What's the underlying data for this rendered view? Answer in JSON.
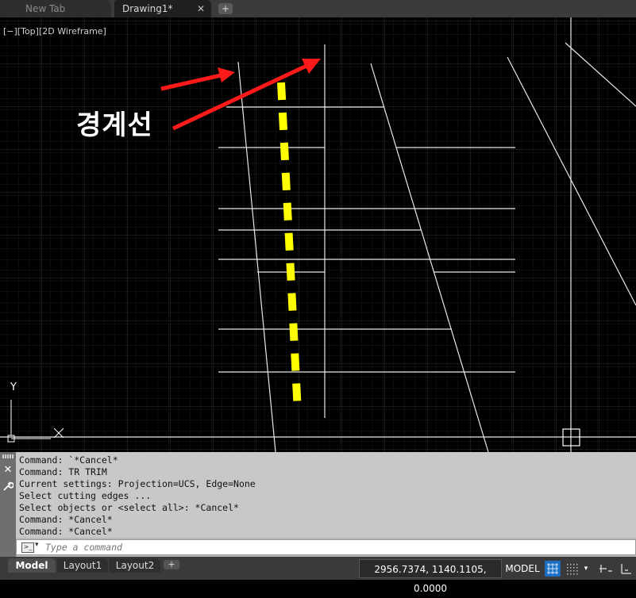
{
  "tabs": {
    "new_tab": "New Tab",
    "drawing_tab": "Drawing1*",
    "close_glyph": "✕",
    "add_glyph": "+"
  },
  "viewport": {
    "view_label": "[−][Top][2D Wireframe]",
    "annotation_text": "경계선",
    "annotation_color": "#ff1a1a",
    "dashed_line_color": "#ffff00",
    "background": "#000000",
    "ucs_y_label": "Y",
    "ucs_x_label": "X"
  },
  "command": {
    "history": [
      "Command: `*Cancel*",
      "Command: TR TRIM",
      "Current settings: Projection=UCS, Edge=None",
      "Select cutting edges ...",
      "Select objects or <select all>: *Cancel*",
      "Command: *Cancel*",
      "Command: *Cancel*"
    ],
    "input_placeholder": "Type a command",
    "close_glyph": "✕",
    "customize_icon": "wrench-icon"
  },
  "statusbar": {
    "layout_tabs": [
      "Model",
      "Layout1",
      "Layout2"
    ],
    "add_glyph": "+",
    "coordinates": "2956.7374, 1140.1105, 0.0000",
    "space_label": "MODEL",
    "grid_on": true
  }
}
